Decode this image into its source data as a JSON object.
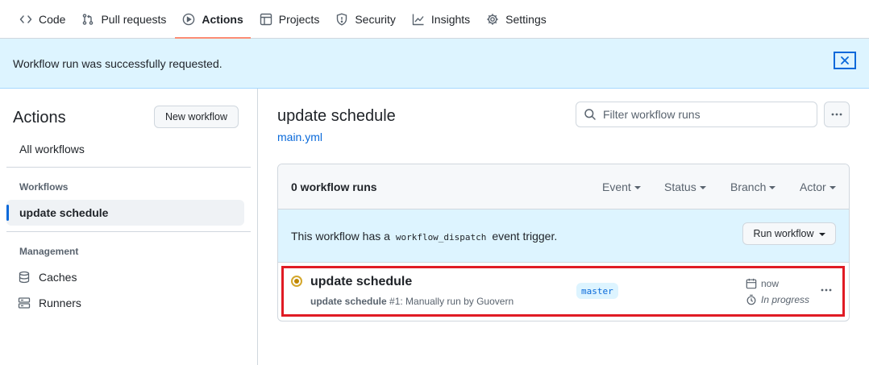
{
  "nav": {
    "tabs": [
      {
        "label": "Code",
        "icon": "code-icon"
      },
      {
        "label": "Pull requests",
        "icon": "pull-request-icon"
      },
      {
        "label": "Actions",
        "icon": "play-icon",
        "active": true
      },
      {
        "label": "Projects",
        "icon": "table-icon"
      },
      {
        "label": "Security",
        "icon": "shield-icon"
      },
      {
        "label": "Insights",
        "icon": "graph-icon"
      },
      {
        "label": "Settings",
        "icon": "gear-icon"
      }
    ]
  },
  "flash": {
    "message": "Workflow run was successfully requested.",
    "close_icon": "x-icon"
  },
  "sidebar": {
    "title": "Actions",
    "new_workflow_label": "New workflow",
    "all_workflows": "All workflows",
    "workflows_heading": "Workflows",
    "active_workflow": "update schedule",
    "management_heading": "Management",
    "management_items": [
      {
        "label": "Caches",
        "icon": "database-icon"
      },
      {
        "label": "Runners",
        "icon": "server-icon"
      }
    ]
  },
  "main": {
    "title": "update schedule",
    "file": "main.yml",
    "filter_placeholder": "Filter workflow runs",
    "runs_count": "0 workflow runs",
    "filters": [
      "Event",
      "Status",
      "Branch",
      "Actor"
    ],
    "dispatch_prefix": "This workflow has a",
    "dispatch_code": "workflow_dispatch",
    "dispatch_suffix": "event trigger.",
    "run_workflow_label": "Run workflow",
    "run": {
      "title": "update schedule",
      "meta_bold": "update schedule",
      "meta_rest": "#1: Manually run by Guovern",
      "branch": "master",
      "time": "now",
      "duration": "In progress",
      "status": "in-progress",
      "status_color": "#bf8700"
    }
  },
  "colors": {
    "accent": "#0969da",
    "active_tab_underline": "#fd8c73",
    "highlight_box": "#e01b24",
    "flash_bg": "#ddf4ff"
  }
}
